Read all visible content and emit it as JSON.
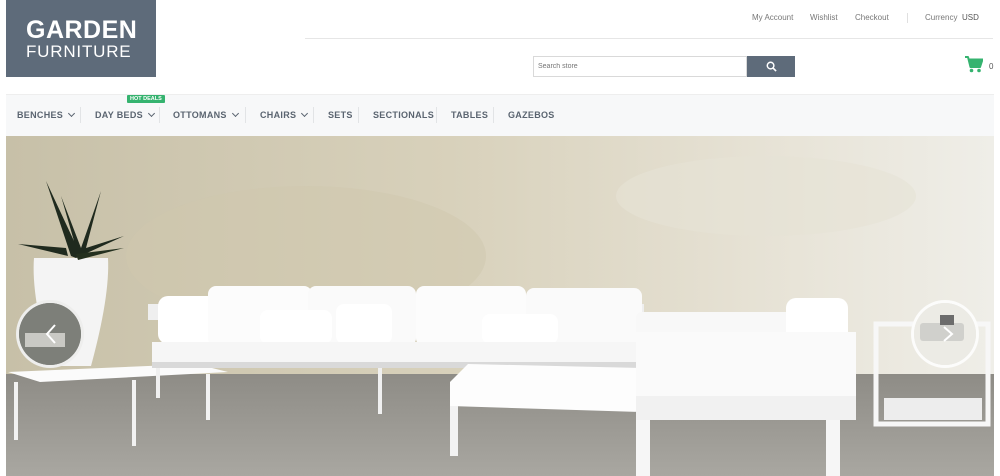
{
  "logo": {
    "line1": "GARDEN",
    "line2": "FURNITURE"
  },
  "top_links": {
    "my_account": "My Account",
    "wishlist": "Wishlist",
    "checkout": "Checkout",
    "currency_label": "Currency",
    "currency_value": "USD"
  },
  "search": {
    "placeholder": "Search store"
  },
  "cart": {
    "count": "0"
  },
  "nav": {
    "items": [
      {
        "label": "BENCHES"
      },
      {
        "label": "DAY BEDS"
      },
      {
        "label": "OTTOMANS"
      },
      {
        "label": "CHAIRS"
      },
      {
        "label": "SETS"
      },
      {
        "label": "SECTIONALS"
      },
      {
        "label": "TABLES"
      },
      {
        "label": "GAZEBOS"
      }
    ],
    "hot_badge": "HOT DEALS"
  },
  "colors": {
    "brand": "#5e6b7a",
    "accent": "#35b36f"
  },
  "icons": {
    "search": "search-icon",
    "cart": "cart-icon",
    "prev": "chevron-left-icon",
    "next": "chevron-right-icon"
  }
}
